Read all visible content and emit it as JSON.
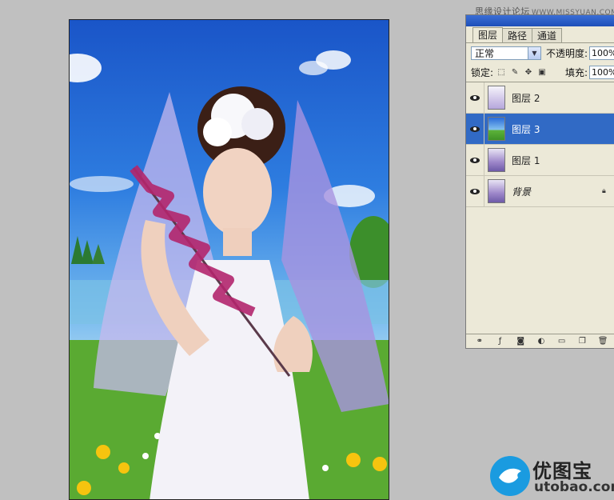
{
  "watermark_top": {
    "site": "思缘设计论坛",
    "url": "WWW.MISSYUAN.COM"
  },
  "layers_panel": {
    "tabs": [
      {
        "label": "图层",
        "active": true
      },
      {
        "label": "路径",
        "active": false
      },
      {
        "label": "通道",
        "active": false
      }
    ],
    "blend_mode": "正常",
    "opacity_label": "不透明度:",
    "opacity_value": "100%",
    "lock_label": "锁定:",
    "fill_label": "填充:",
    "fill_value": "100%",
    "layers": [
      {
        "name": "图层 2",
        "thumb": "bride-white",
        "selected": false,
        "visible": true
      },
      {
        "name": "图层 3",
        "thumb": "scene",
        "selected": true,
        "visible": true
      },
      {
        "name": "图层 1",
        "thumb": "bride",
        "selected": false,
        "visible": true
      },
      {
        "name": "背景",
        "thumb": "bride",
        "selected": false,
        "visible": true,
        "locked": true
      }
    ],
    "bottom_icons": [
      "link-layers-icon",
      "layer-style-icon",
      "mask-icon",
      "adjustment-layer-icon",
      "new-group-icon",
      "new-layer-icon",
      "trash-icon"
    ]
  },
  "logo": {
    "cn_text": "优图宝",
    "en_text": "utobao.com",
    "color": "#1a9be0"
  },
  "colors": {
    "selection": "#316ac5",
    "panel_bg": "#ece9d8",
    "workspace_bg": "#c0c0c0"
  }
}
